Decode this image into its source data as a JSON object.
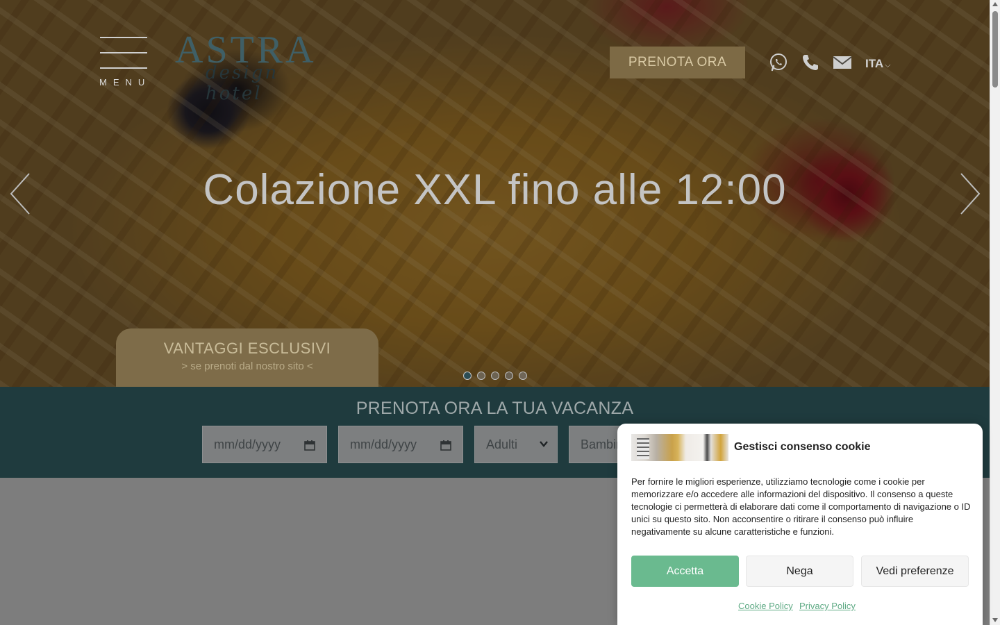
{
  "header": {
    "menu_label": "MENU",
    "logo_main": "ASTRA",
    "logo_sub": "design hotel",
    "book_button": "PRENOTA ORA",
    "icons": [
      "whatsapp-icon",
      "phone-icon",
      "mail-icon"
    ],
    "language": "ITA"
  },
  "hero": {
    "headline": "Colazione XXL fino alle 12:00",
    "promo_title": "VANTAGGI ESCLUSIVI",
    "promo_subtitle": "> se prenoti dal nostro sito <",
    "slide_count": 5,
    "active_slide": 1
  },
  "booking": {
    "title": "PRENOTA ORA LA TUA VACANZA",
    "checkin_placeholder": "mm/dd/yyyy",
    "checkout_placeholder": "mm/dd/yyyy",
    "adults_label": "Adulti",
    "children_label": "Bambini"
  },
  "cookie": {
    "title": "Gestisci consenso cookie",
    "text": "Per fornire le migliori esperienze, utilizziamo tecnologie come i cookie per memorizzare e/o accedere alle informazioni del dispositivo. Il consenso a queste tecnologie ci permetterà di elaborare dati come il comportamento di navigazione o ID unici su questo sito. Non acconsentire o ritirare il consenso può influire negativamente su alcune caratteristiche e funzioni.",
    "accept": "Accetta",
    "deny": "Nega",
    "preferences": "Vedi preferenze",
    "cookie_policy": "Cookie Policy",
    "privacy_policy": "Privacy Policy"
  },
  "colors": {
    "accent_gold": "#7d6a45",
    "booking_bar": "#1f3b3e",
    "accept_green": "#6aba8f"
  }
}
